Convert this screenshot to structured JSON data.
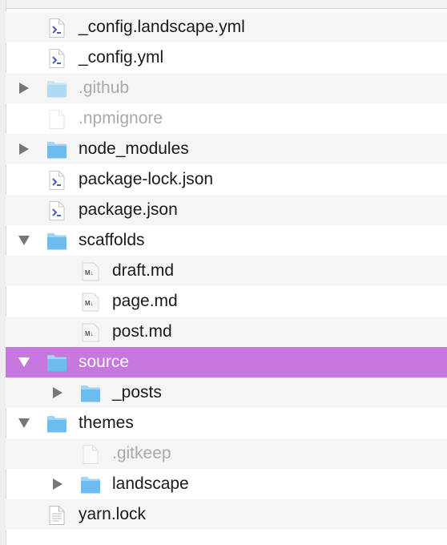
{
  "colors": {
    "selection": "#c678de",
    "folder": "#6cbcf0",
    "alt_row": "#f5f5f5",
    "dim_text": "#a9a9a9"
  },
  "tree": [
    {
      "label": "_config.landscape.yml",
      "icon": "yaml-file-icon",
      "level": 0,
      "disclosure": "none"
    },
    {
      "label": "_config.yml",
      "icon": "yaml-file-icon",
      "level": 0,
      "disclosure": "none"
    },
    {
      "label": ".github",
      "icon": "folder-icon",
      "level": 0,
      "disclosure": "collapsed",
      "dim": true
    },
    {
      "label": ".npmignore",
      "icon": "blank-file-icon",
      "level": 0,
      "disclosure": "none",
      "dim": true
    },
    {
      "label": "node_modules",
      "icon": "folder-icon",
      "level": 0,
      "disclosure": "collapsed"
    },
    {
      "label": "package-lock.json",
      "icon": "json-file-icon",
      "level": 0,
      "disclosure": "none"
    },
    {
      "label": "package.json",
      "icon": "json-file-icon",
      "level": 0,
      "disclosure": "none"
    },
    {
      "label": "scaffolds",
      "icon": "folder-icon",
      "level": 0,
      "disclosure": "expanded"
    },
    {
      "label": "draft.md",
      "icon": "markdown-file-icon",
      "level": 1,
      "disclosure": "none"
    },
    {
      "label": "page.md",
      "icon": "markdown-file-icon",
      "level": 1,
      "disclosure": "none"
    },
    {
      "label": "post.md",
      "icon": "markdown-file-icon",
      "level": 1,
      "disclosure": "none"
    },
    {
      "label": "source",
      "icon": "folder-icon",
      "level": 0,
      "disclosure": "expanded",
      "selected": true
    },
    {
      "label": "_posts",
      "icon": "folder-icon",
      "level": 1,
      "disclosure": "collapsed"
    },
    {
      "label": "themes",
      "icon": "folder-icon",
      "level": 0,
      "disclosure": "expanded"
    },
    {
      "label": ".gitkeep",
      "icon": "blank-file-icon",
      "level": 1,
      "disclosure": "none",
      "dim": true
    },
    {
      "label": "landscape",
      "icon": "folder-icon",
      "level": 1,
      "disclosure": "collapsed"
    },
    {
      "label": "yarn.lock",
      "icon": "text-file-icon",
      "level": 0,
      "disclosure": "none"
    }
  ]
}
